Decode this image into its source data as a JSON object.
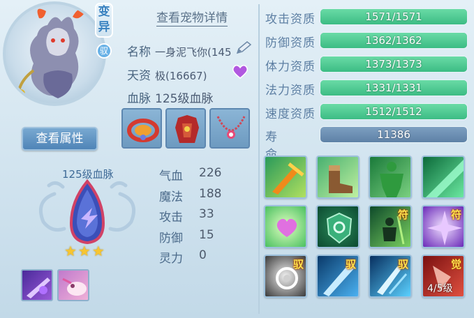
{
  "header": {
    "variant_badge": "变异",
    "tame_badge": "驭",
    "details_link": "查看宠物详情",
    "view_attributes_button": "查看属性"
  },
  "pet": {
    "name_label": "名称",
    "name_value": "一身泥飞你(145",
    "talent_label": "天资",
    "talent_value": "极(16667)",
    "bloodline_label": "血脉",
    "bloodline_value": "125级血脉"
  },
  "bloodline_emblem": {
    "title": "125级血脉",
    "stars": "★★★"
  },
  "stats": [
    {
      "label": "气血",
      "value": "226"
    },
    {
      "label": "魔法",
      "value": "188"
    },
    {
      "label": "攻击",
      "value": "33"
    },
    {
      "label": "防御",
      "value": "15"
    },
    {
      "label": "灵力",
      "value": "0"
    }
  ],
  "aptitudes": [
    {
      "label": "攻击资质",
      "text": "1571/1571",
      "fill": 1.0
    },
    {
      "label": "防御资质",
      "text": "1362/1362",
      "fill": 1.0
    },
    {
      "label": "体力资质",
      "text": "1373/1373",
      "fill": 1.0
    },
    {
      "label": "法力资质",
      "text": "1331/1331",
      "fill": 1.0
    },
    {
      "label": "速度资质",
      "text": "1512/1512",
      "fill": 1.0
    }
  ],
  "life": {
    "label": "寿命",
    "value": "11386"
  },
  "skill_tags": {
    "fu": "符",
    "yu": "驭",
    "jue": "觉",
    "level": "4/5级"
  },
  "colors": {
    "aptitude_fill": "#3cbc84",
    "life_bar": "#6e8fb0",
    "star": "#f7c531"
  }
}
